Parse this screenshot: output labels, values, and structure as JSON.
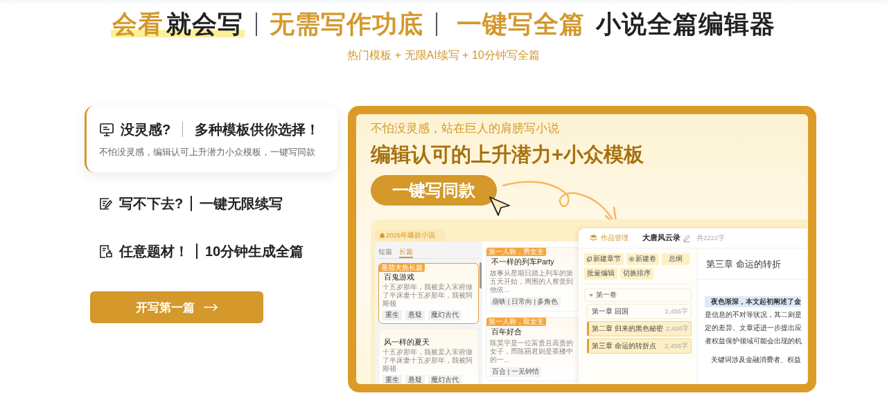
{
  "header": {
    "title_parts": [
      {
        "text": "会看",
        "color": "#d4982b",
        "underlined": true,
        "divider": false
      },
      {
        "text": "就会写",
        "color": "#222222",
        "underlined": true,
        "divider": true
      },
      {
        "text": "无需写作功底",
        "color": "#d4982b",
        "underlined": false,
        "divider": true
      },
      {
        "text": "一键写全篇",
        "color": "#d4982b",
        "underlined": false,
        "divider": false
      },
      {
        "text": "小说全篇编辑器",
        "color": "#222222",
        "underlined": false,
        "divider": false
      }
    ],
    "subtitle": "热门模板 + 无限AI续写 + 10分钟写全篇"
  },
  "features": [
    {
      "title": "没灵感?",
      "subtitle": "多种模板供你选择！",
      "description": "不怕没灵感，编辑认可上升潜力小众模板，一键写同款",
      "selected": true
    },
    {
      "title": "写不下去?",
      "subtitle": "一键无限续写",
      "selected": false
    },
    {
      "title": "任意题材！",
      "subtitle": "10分钟生成全篇",
      "selected": false
    }
  ],
  "start_button": {
    "label": "开写第一篇"
  },
  "showcase": {
    "eyebrow": "不怕没灵感，站在巨人的肩膀写小说",
    "headline": "编辑认可的上升潜力+小众模板",
    "cta": "一键写同款",
    "library": {
      "title": "2025年爆款小说",
      "tabs": [
        {
          "label": "短篇",
          "selected": false
        },
        {
          "label": "长篇",
          "selected": true
        }
      ],
      "cards": [
        {
          "tag": "番茄大热长篇",
          "title": "百鬼游戏",
          "excerpt": "十五岁那年，我被卖入宋府做了半床妻十五岁那年，我被阿斯顿",
          "tags": [
            "重生",
            "悬疑",
            "魔幻古代"
          ],
          "selected": true
        },
        {
          "title": "风一样的夏天",
          "excerpt": "十五岁那年，我被卖入宋府做了半床妻十五岁那年，我被阿斯顿",
          "tags": [
            "重生",
            "悬疑",
            "魔幻古代"
          ],
          "selected": false
        }
      ]
    },
    "stories": [
      {
        "tag": "第一人称，男女主",
        "title": "不一样的列车Party",
        "excerpt": "故事从星期日踏上列车的第五天开始，周围的人察觉到他依...",
        "meta": "崩铁 | 日常向 | 多角色"
      },
      {
        "tag": "第一人称，双女主",
        "title": "百年好合",
        "excerpt": "陈昊宇是一位富贵且高贵的女子，而陈丽君则是茶楼中的一...",
        "meta": "百合 | 一见钟情"
      }
    ],
    "editor": {
      "section": "作品管理",
      "book_title": "大唐风云录",
      "word_count": "共2222字",
      "actions": [
        "新建章节",
        "新建卷",
        "总纲",
        "批量编辑",
        "切换排序"
      ],
      "volumes": [
        {
          "label": "第一卷",
          "expanded": true,
          "children": [
            {
              "label": "第一章 回国",
              "count": "2,456字",
              "selected": false
            },
            {
              "label": "第二章 归来的黑色秘密",
              "count": "2,456字",
              "selected": true
            },
            {
              "label": "第三章 命运的转折点",
              "count": "2,456字",
              "selected": true
            }
          ]
        }
      ],
      "chapter_title": "第三章 命运的转折",
      "paragraphs": [
        {
          "lines": [
            {
              "text": "夜色渐深，本文起初阐述了金",
              "highlighted": true
            },
            {
              "text": "是信息的不对等状况，其二则是",
              "highlighted": false
            },
            {
              "text": "定的差异。文章还进一步提出应",
              "highlighted": false
            },
            {
              "text": "者权益保护领域可能会出现的机",
              "highlighted": false
            }
          ]
        },
        {
          "lines": [
            {
              "text": "关键词涉及金融消费者、权益",
              "highlighted": false
            }
          ]
        }
      ]
    }
  }
}
